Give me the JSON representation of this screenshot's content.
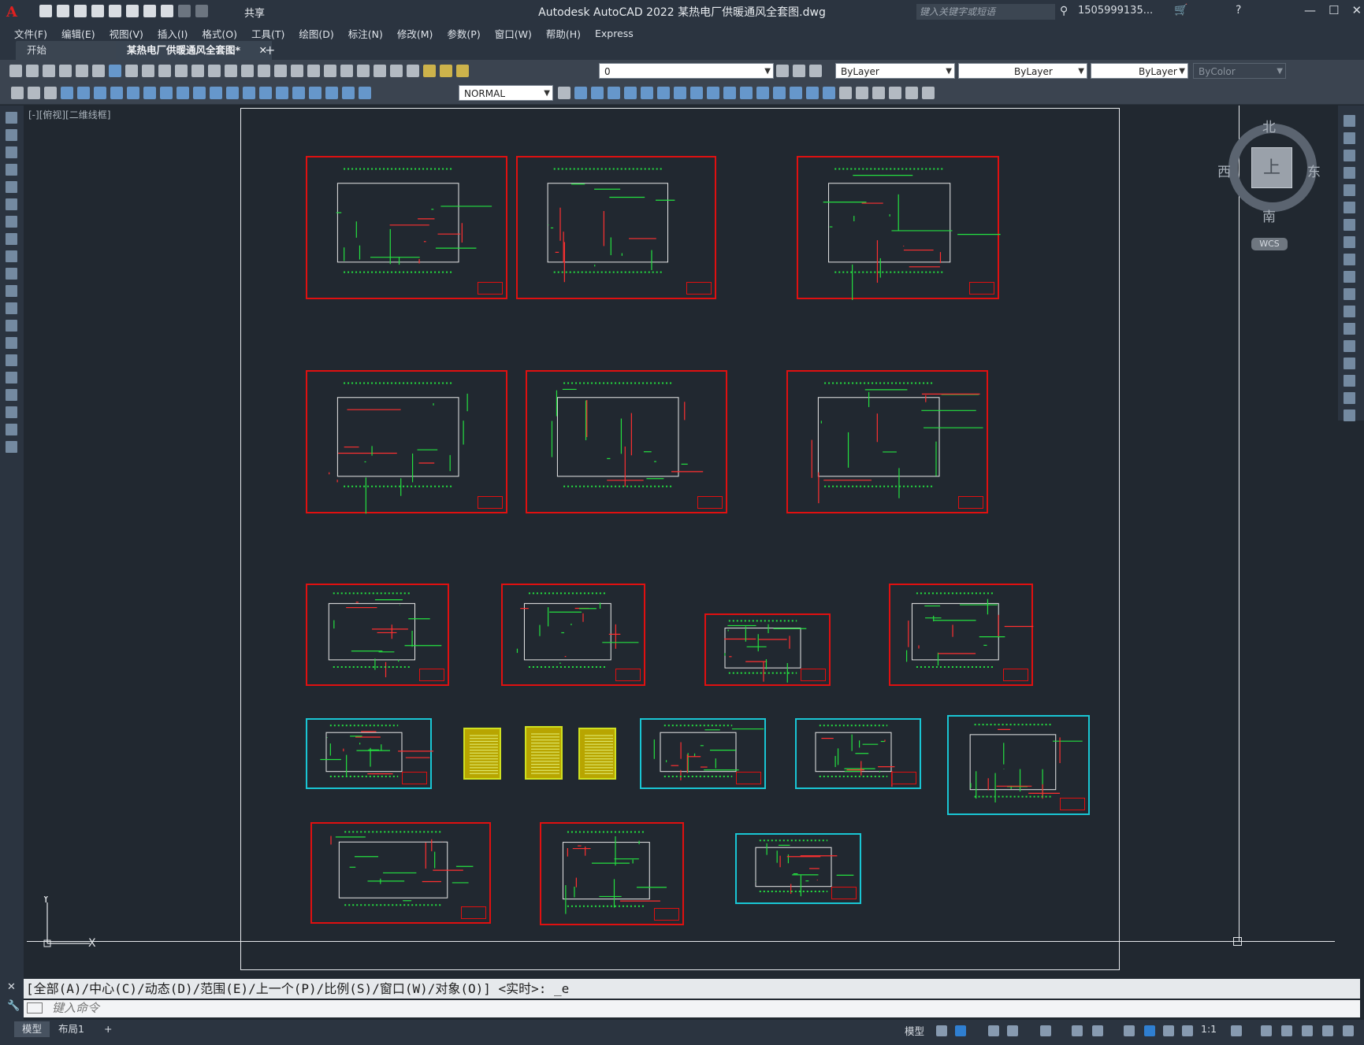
{
  "title_bar": {
    "app_logo": "A",
    "share_label": "共享",
    "window_title": "Autodesk AutoCAD 2022    某热电厂供暖通风全套图.dwg",
    "search_placeholder": "键入关键字或短语",
    "user_name": "1505999135...",
    "min": "—",
    "max": "☐",
    "close": "✕"
  },
  "menu": {
    "items": [
      "文件(F)",
      "编辑(E)",
      "视图(V)",
      "插入(I)",
      "格式(O)",
      "工具(T)",
      "绘图(D)",
      "标注(N)",
      "修改(M)",
      "参数(P)",
      "窗口(W)",
      "帮助(H)",
      "Express"
    ]
  },
  "tabs": {
    "start": "开始",
    "document": "某热电厂供暖通风全套图*",
    "close": "✕",
    "add": "+"
  },
  "toolbar1": {
    "layer_value": "0",
    "color_value": "ByLayer",
    "linetype_value": "ByLayer",
    "lineweight_value": "ByLayer",
    "plotstyle_value": "ByColor"
  },
  "toolbar2": {
    "style_value": "NORMAL"
  },
  "viewport": {
    "label": "[-][俯视][二维线框]"
  },
  "viewcube": {
    "north": "北",
    "south": "南",
    "east": "东",
    "west": "西",
    "top_face": "上",
    "wcs": "WCS"
  },
  "ucs": {
    "x": "X",
    "y": "Y"
  },
  "command_line": {
    "history": "[全部(A)/中心(C)/动态(D)/范围(E)/上一个(P)/比例(S)/窗口(W)/对象(O)] <实时>: _e",
    "placeholder": "键入命令"
  },
  "status_bar": {
    "model_tab": "模型",
    "layout1_tab": "布局1",
    "add_tab": "+",
    "model_space": "模型",
    "annotation_scale": "1:1"
  },
  "colors": {
    "canvas": "#212830",
    "sheet_red": "#e01010",
    "sheet_cyan": "#19c6d4",
    "drawing_green": "#24e040"
  }
}
